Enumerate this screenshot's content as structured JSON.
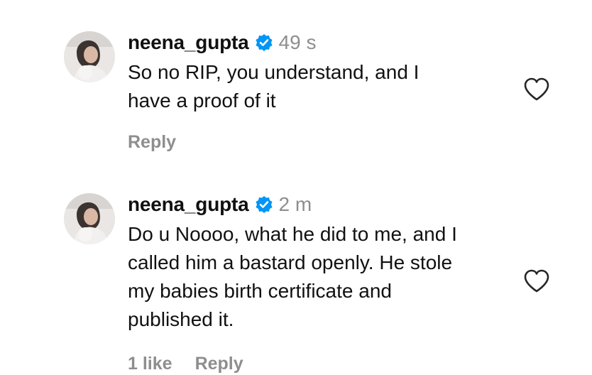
{
  "comments": [
    {
      "username": "neena_gupta",
      "timestamp": "49 s",
      "text": "So no RIP, you understand, and I\nhave a proof of it",
      "likes": "",
      "reply_label": "Reply",
      "icons": {
        "avatar": "profile-photo",
        "verified": "verified-badge-icon",
        "like": "heart-outline-icon"
      }
    },
    {
      "username": "neena_gupta",
      "timestamp": "2 m",
      "text": "Do u Noooo, what he did to me, and I\ncalled him a bastard openly. He stole\nmy babies birth certificate and\npublished it.",
      "likes": "1 like",
      "reply_label": "Reply",
      "icons": {
        "avatar": "profile-photo",
        "verified": "verified-badge-icon",
        "like": "heart-outline-icon"
      }
    }
  ],
  "colors": {
    "text": "#111111",
    "muted": "#8e8e8e",
    "verified": "#0095f6"
  }
}
